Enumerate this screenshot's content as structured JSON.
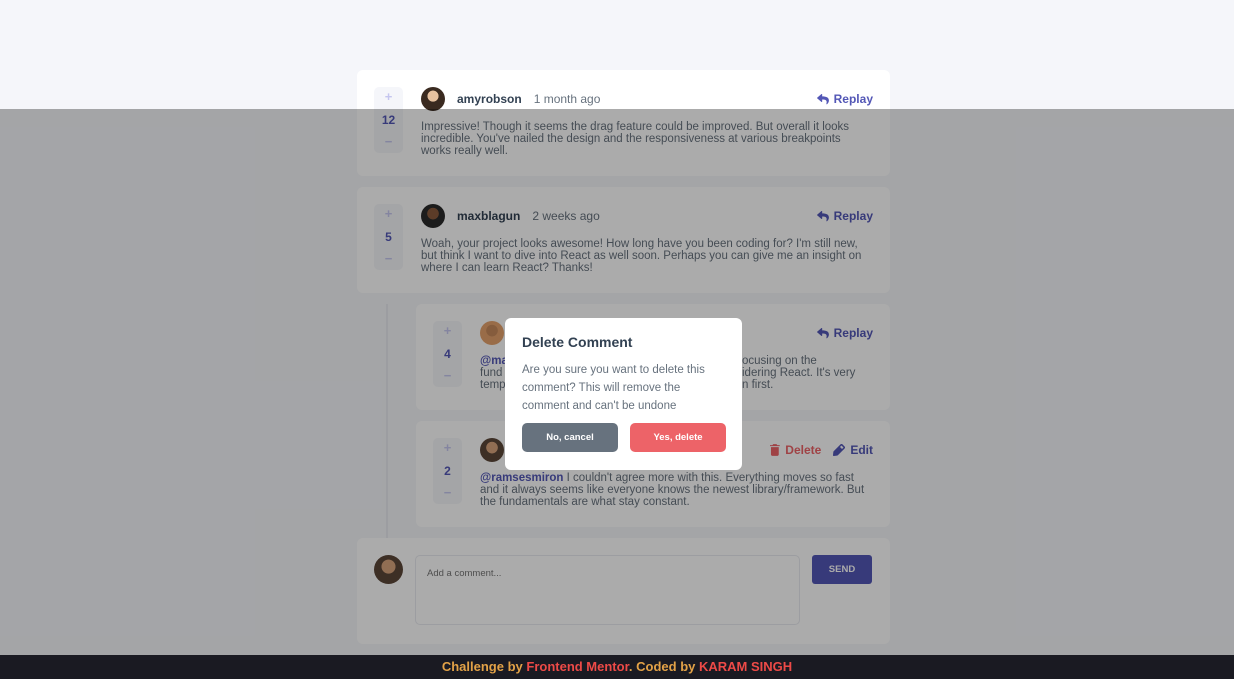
{
  "colors": {
    "primary": "#5357b6",
    "danger": "#ed6368",
    "cancel": "#67727e",
    "footer_bg": "#1a1a22",
    "footer_text": "#e3a247",
    "footer_link": "#ed4a47"
  },
  "comments": [
    {
      "username": "amyrobson",
      "time": "1 month ago",
      "score": "12",
      "text": "Impressive! Though it seems the drag feature could be improved. But overall it looks incredible. You've nailed the design and the responsiveness at various breakpoints works really well.",
      "action": "Replay"
    },
    {
      "username": "maxblagun",
      "time": "2 weeks ago",
      "score": "5",
      "text": "Woah, your project looks awesome! How long have you been coding for? I'm still new, but think I want to dive into React as well soon. Perhaps you can give me an insight on where I can learn React? Thanks!",
      "action": "Replay"
    }
  ],
  "replies": [
    {
      "score": "4",
      "mention": "@ma",
      "text_left": "fund",
      "text_left3": "temp",
      "text_right1": "ocusing on the",
      "text_right2": "idering React. It's very",
      "text_right3": "n first.",
      "action": "Replay"
    },
    {
      "score": "2",
      "mention": "@ramsesmiron",
      "text": " I couldn't agree more with this. Everything moves so fast and it always seems like everyone knows the newest library/framework. But the fundamentals are what stay constant.",
      "delete_label": "Delete",
      "edit_label": "Edit"
    }
  ],
  "vote": {
    "plus": "+",
    "minus": "−"
  },
  "composer": {
    "placeholder": "Add a comment...",
    "send_label": "SEND"
  },
  "modal": {
    "title": "Delete Comment",
    "text": "Are you sure you want to delete this comment? This will remove the comment and can't be undone",
    "cancel_label": "No, cancel",
    "confirm_label": "Yes, delete"
  },
  "footer": {
    "prefix": "Challenge by ",
    "link1": "Frontend Mentor",
    "middle": ". Coded by ",
    "link2": "KARAM SINGH"
  },
  "icons": {
    "reply": "reply-icon",
    "delete": "trash-icon",
    "edit": "pencil-icon"
  }
}
